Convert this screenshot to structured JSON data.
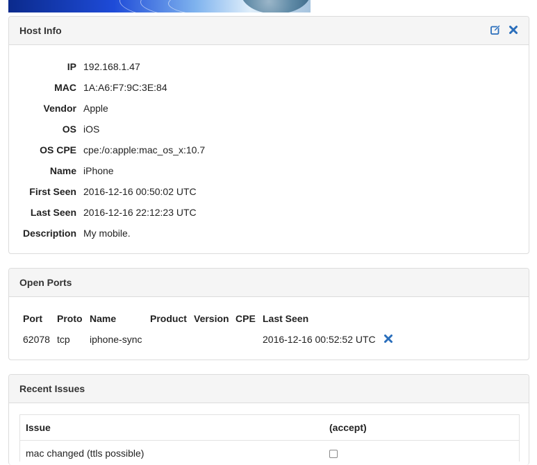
{
  "host_info": {
    "title": "Host Info",
    "fields": [
      {
        "label": "IP",
        "value": "192.168.1.47"
      },
      {
        "label": "MAC",
        "value": "1A:A6:F7:9C:3E:84"
      },
      {
        "label": "Vendor",
        "value": "Apple"
      },
      {
        "label": "OS",
        "value": "iOS"
      },
      {
        "label": "OS CPE",
        "value": "cpe:/o:apple:mac_os_x:10.7"
      },
      {
        "label": "Name",
        "value": "iPhone"
      },
      {
        "label": "First Seen",
        "value": "2016-12-16 00:50:02 UTC"
      },
      {
        "label": "Last Seen",
        "value": "2016-12-16 22:12:23 UTC"
      },
      {
        "label": "Description",
        "value": "My mobile."
      }
    ],
    "edit_icon": "edit-icon",
    "close_icon": "close-icon"
  },
  "open_ports": {
    "title": "Open Ports",
    "columns": [
      "Port",
      "Proto",
      "Name",
      "Product",
      "Version",
      "CPE",
      "Last Seen"
    ],
    "rows": [
      {
        "port": "62078",
        "proto": "tcp",
        "name": "iphone-sync",
        "product": "",
        "version": "",
        "cpe": "",
        "last_seen": "2016-12-16 00:52:52 UTC"
      }
    ]
  },
  "recent_issues": {
    "title": "Recent Issues",
    "columns": [
      "Issue",
      "(accept)"
    ],
    "rows": [
      {
        "issue": "mac changed (ttls possible)"
      }
    ]
  },
  "colors": {
    "accent": "#2a6ebb"
  }
}
